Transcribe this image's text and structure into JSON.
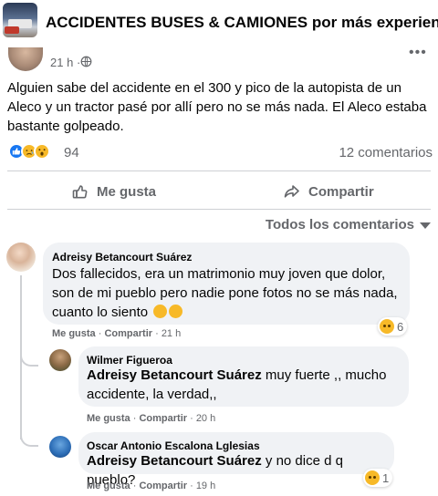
{
  "header": {
    "group_name": "ACCIDENTES BUSES & CAMIONES por más experiencia y"
  },
  "post": {
    "time": "21 h",
    "dot": "·",
    "text": "Alguien sabe del accidente en el 300 y pico de la autopista de un Aleco y un tractor pasé por allí pero no se más nada. El Aleco estaba bastante golpeado.",
    "reaction_count": "94",
    "comments_count": "12 comentarios",
    "reactions": [
      "like-icon",
      "sad-icon",
      "wow-icon"
    ]
  },
  "actions": {
    "like_label": "Me gusta",
    "share_label": "Compartir"
  },
  "sort": {
    "label": "Todos los comentarios"
  },
  "comments": [
    {
      "author": "Adreisy Betancourt Suárez",
      "text": "Dos fallecidos, era un matrimonio muy joven que dolor, son de mi pueblo pero nadie pone fotos no se más nada, cuanto lo siento",
      "like": "Me gusta",
      "reply": "Compartir",
      "time": "21 h",
      "reaction_count": "6"
    },
    {
      "author": "Wilmer Figueroa",
      "mention": "Adreisy Betancourt Suárez",
      "text": " muy fuerte ,, mucho accidente, la verdad,,",
      "like": "Me gusta",
      "reply": "Compartir",
      "time": "20 h"
    },
    {
      "author": "Oscar Antonio Escalona Lglesias",
      "mention": "Adreisy Betancourt Suárez",
      "text": " y no dice d q pueblo?",
      "like": "Me gusta",
      "reply": "Compartir",
      "time": "19 h",
      "reaction_count": "1"
    }
  ],
  "colors": {
    "accent": "#1877f2",
    "secondary_text": "#65676b",
    "bubble": "#f0f2f5",
    "sad": "#f7b928"
  }
}
